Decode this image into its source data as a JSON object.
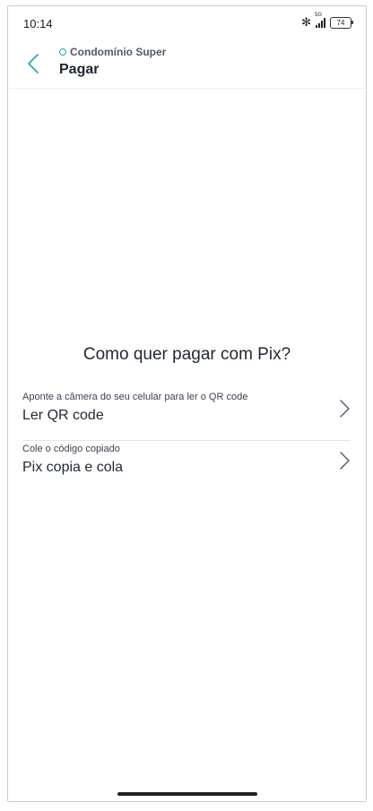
{
  "status_bar": {
    "time": "10:14",
    "network": "5G",
    "battery": "74",
    "icons": [
      "bluetooth-icon",
      "signal-icon",
      "battery-icon"
    ]
  },
  "header": {
    "condominium": "Condomínio Super",
    "title": "Pagar",
    "back_icon": "chevron-left-icon"
  },
  "main": {
    "question": "Como quer pagar com Pix?",
    "options": [
      {
        "hint": "Aponte a câmera do seu celular para ler o QR code",
        "label": "Ler QR code"
      },
      {
        "hint": "Cole o código copiado",
        "label": "Pix copia e cola"
      }
    ]
  },
  "colors": {
    "accent": "#2aa8b8",
    "text_primary": "#1f2733",
    "text_secondary": "#4f5b6b",
    "divider": "#e3e5e9"
  }
}
